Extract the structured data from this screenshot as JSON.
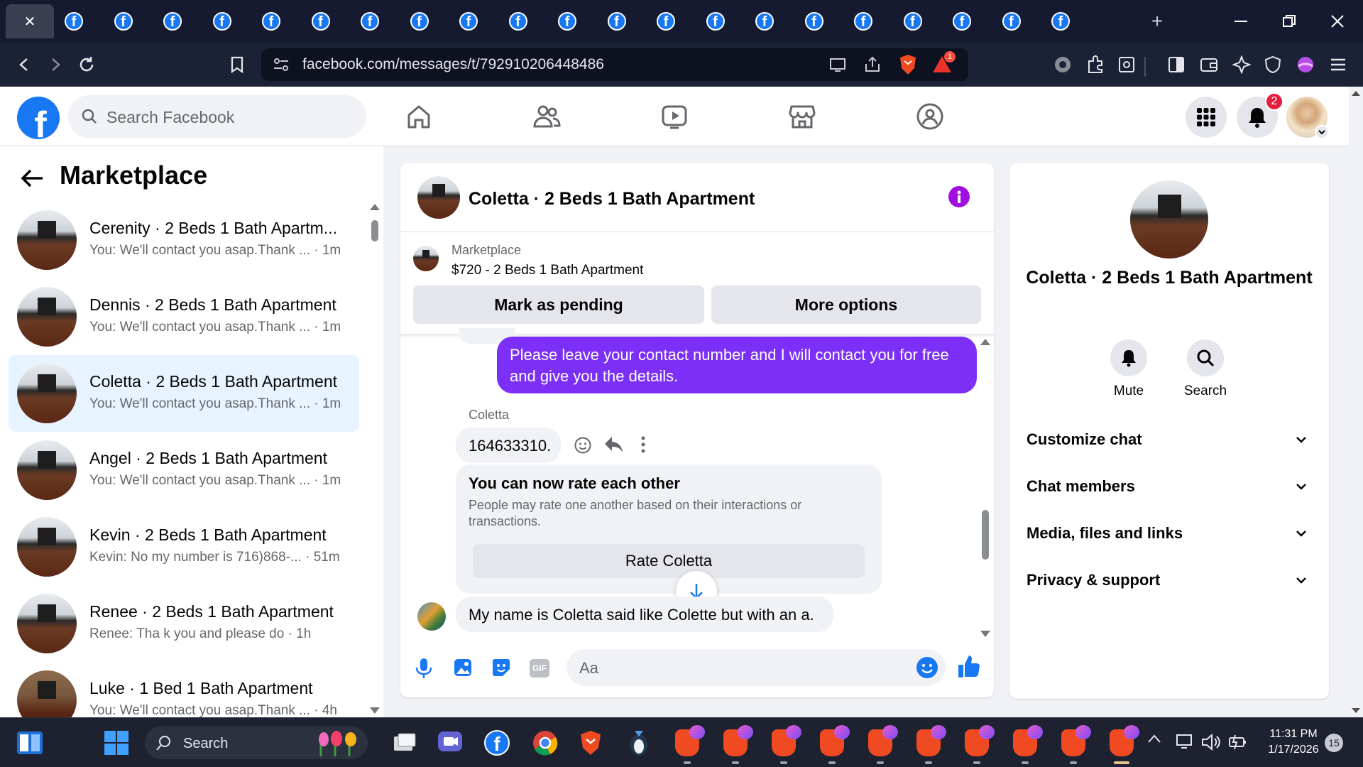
{
  "browser": {
    "close_tab_label": "✕",
    "tab_favicon_letter": "f",
    "new_tab_label": "+",
    "url": "facebook.com/messages/t/792910206448486",
    "alerts_badge": "1"
  },
  "fb_header": {
    "logo_letter": "f",
    "search_placeholder": "Search Facebook",
    "notifications_badge": "2"
  },
  "left_panel": {
    "title": "Marketplace",
    "conversations": [
      {
        "name": "Cerenity · 2 Beds 1 Bath Apartm...",
        "preview": "You: We'll contact you asap.Thank ... · 1m"
      },
      {
        "name": "Dennis · 2 Beds 1 Bath Apartment",
        "preview": "You: We'll contact you asap.Thank ... · 1m"
      },
      {
        "name": "Coletta · 2 Beds 1 Bath Apartment",
        "preview": "You: We'll contact you asap.Thank ... · 1m"
      },
      {
        "name": "Angel · 2 Beds 1 Bath Apartment",
        "preview": "You: We'll contact you asap.Thank ... · 1m"
      },
      {
        "name": "Kevin · 2 Beds 1 Bath Apartment",
        "preview": "Kevin: No my number is 716)868-... · 51m"
      },
      {
        "name": "Renee · 2 Beds 1 Bath Apartment",
        "preview": "Renee: Tha k you and please do · 1h"
      },
      {
        "name": "Luke · 1 Bed 1 Bath Apartment",
        "preview": "You: We'll contact you asap.Thank ... · 4h"
      }
    ]
  },
  "chat": {
    "title": "Coletta · 2 Beds 1 Bath Apartment",
    "listing_category": "Marketplace",
    "listing_title": "$720 - 2 Beds 1 Bath Apartment",
    "mark_pending_label": "Mark as pending",
    "more_options_label": "More options",
    "outgoing_message": "Please leave your contact number and I will contact you for free and give you the details.",
    "sender_name": "Coletta",
    "incoming_message_1": "164633310.",
    "rate_card_title": "You can now rate each other",
    "rate_card_body": "People may rate one another based on their interactions or transactions.",
    "rate_button_label": "Rate Coletta",
    "incoming_message_2": "My name is Coletta said like Colette but with an a.",
    "composer_placeholder": "Aa",
    "gif_label": "GIF"
  },
  "right_panel": {
    "name": "Coletta · 2 Beds 1 Bath Apartment",
    "mute_label": "Mute",
    "search_label": "Search",
    "sections": [
      "Customize chat",
      "Chat members",
      "Media, files and links",
      "Privacy & support"
    ]
  },
  "taskbar": {
    "search_label": "Search",
    "time": "11:31 PM",
    "date": "1/17/2026",
    "notification_count": "15"
  },
  "colors": {
    "facebook_blue": "#1877f2",
    "messenger_purple": "#7b2ff7",
    "brave_orange": "#f04a23",
    "tab_strip": "#151a30"
  }
}
